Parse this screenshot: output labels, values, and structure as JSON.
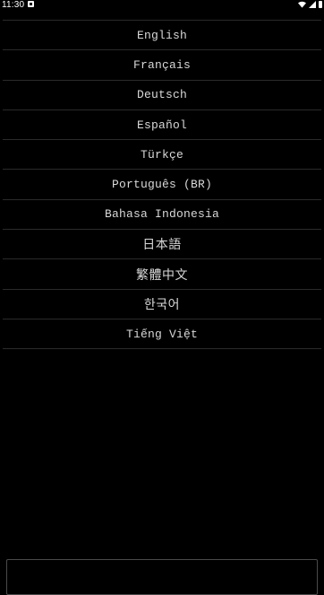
{
  "status_bar": {
    "time": "11:30",
    "notification_icon": "app-notification-icon",
    "wifi_icon": "wifi-icon",
    "signal_icon": "signal-icon",
    "battery_icon": "battery-icon"
  },
  "languages": [
    {
      "label": "English"
    },
    {
      "label": "Français"
    },
    {
      "label": "Deutsch"
    },
    {
      "label": "Español"
    },
    {
      "label": "Türkçe"
    },
    {
      "label": "Português (BR)"
    },
    {
      "label": "Bahasa Indonesia"
    },
    {
      "label": "日本語"
    },
    {
      "label": "繁體中文"
    },
    {
      "label": "한국어"
    },
    {
      "label": "Tiếng Việt"
    }
  ],
  "colors": {
    "background": "#000000",
    "text": "#d8d8d8",
    "divider": "#2a2a2a"
  }
}
